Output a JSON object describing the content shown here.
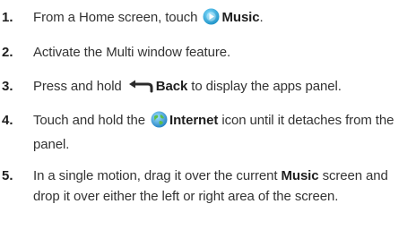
{
  "steps": [
    {
      "number": "1.",
      "text_before": "From a Home screen, touch ",
      "icon": "music-app-icon",
      "bold": "Music",
      "text_after": "."
    },
    {
      "number": "2.",
      "text": "Activate the Multi window feature."
    },
    {
      "number": "3.",
      "text_before": "Press and hold ",
      "icon": "back-arrow-icon",
      "bold": "Back",
      "text_after": " to display the apps panel."
    },
    {
      "number": "4.",
      "text_before": "Touch and hold the ",
      "icon": "internet-globe-icon",
      "bold": "Internet",
      "text_after": " icon until it detaches from the panel."
    },
    {
      "number": "5.",
      "text_before": "In a single motion, drag it over the current ",
      "bold": "Music",
      "text_after": " screen and drop it over either the left or right area of the screen."
    }
  ],
  "colors": {
    "music_icon": "#2fb4e3",
    "internet_icon": "#3aa0dc",
    "text": "#333333"
  }
}
